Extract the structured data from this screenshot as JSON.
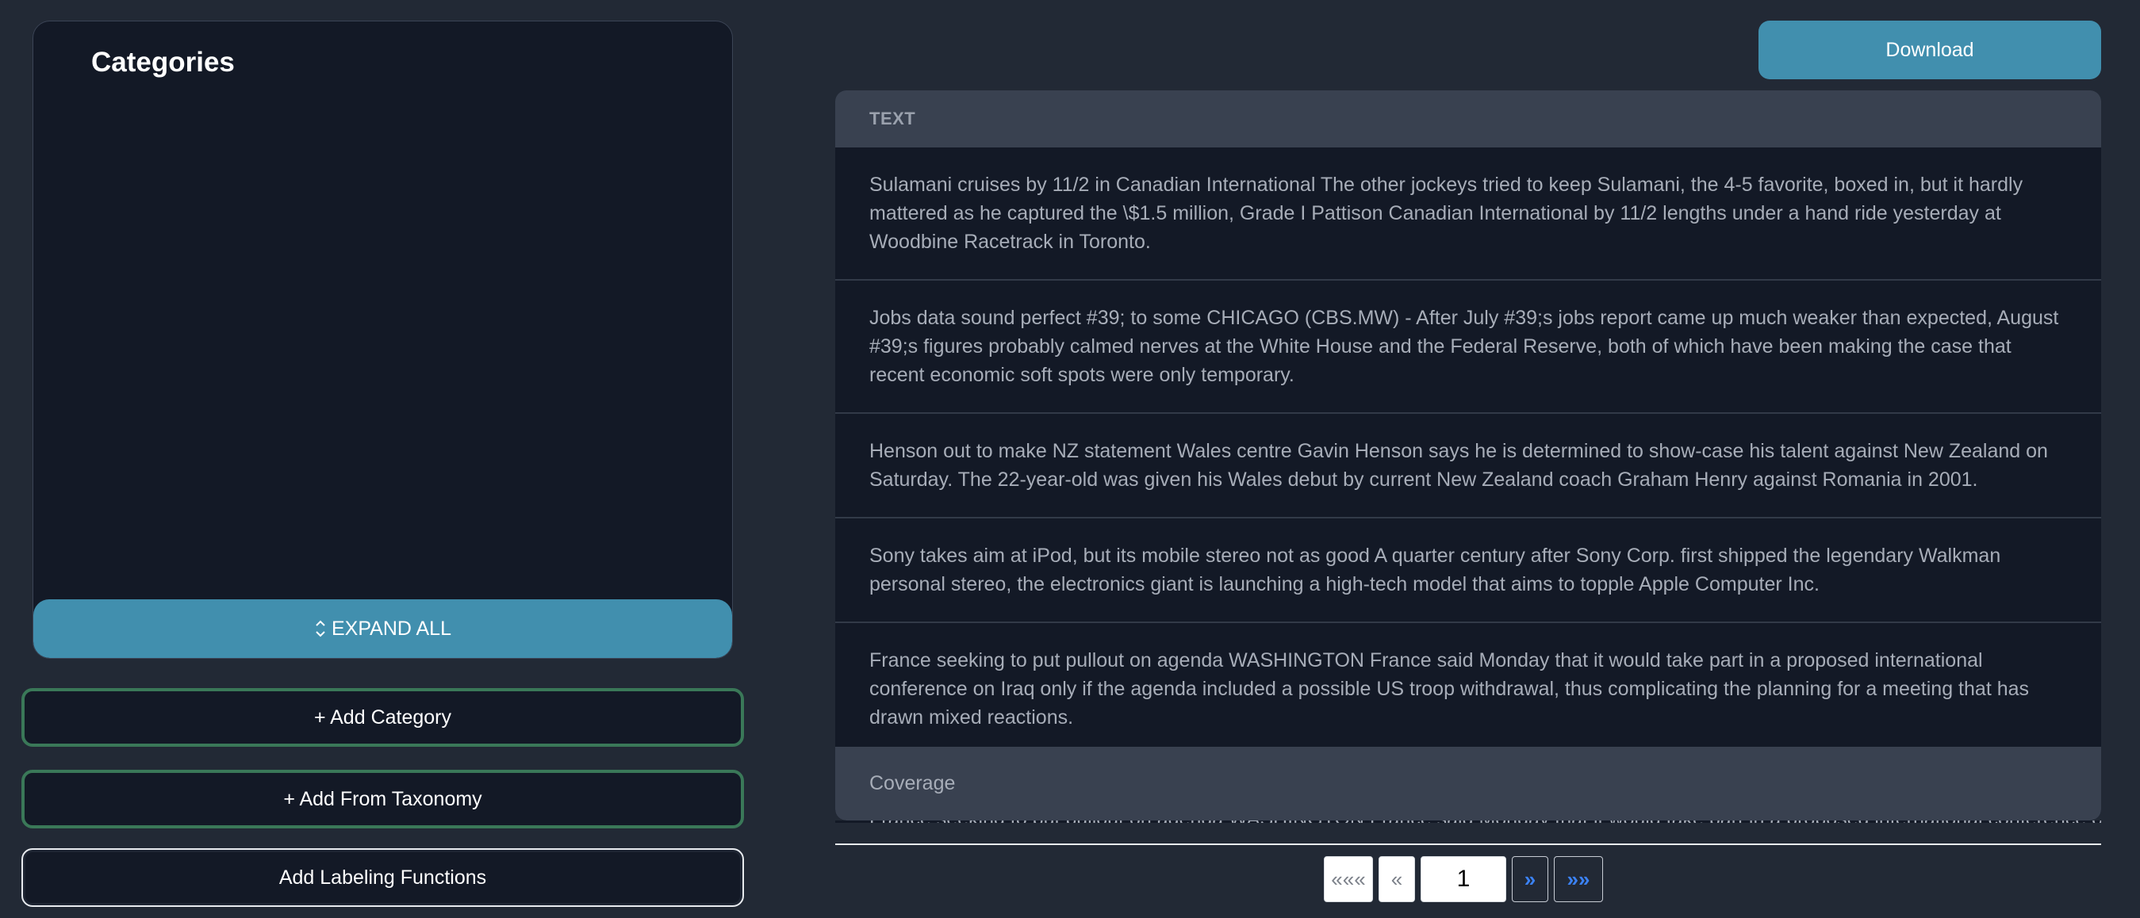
{
  "sidebar": {
    "title": "Categories",
    "expand_all_label": "EXPAND ALL",
    "expand_icon": "chevron-up-down-icon",
    "add_category_label": "+ Add Category",
    "add_from_taxonomy_label": "+ Add From Taxonomy",
    "add_labeling_functions_label": "Add Labeling Functions"
  },
  "toolbar": {
    "download_label": "Download"
  },
  "table": {
    "column_header": "TEXT",
    "rows": [
      {
        "text": "Sulamani cruises by 11/2 in Canadian International The other jockeys tried to keep Sulamani, the 4-5 favorite, boxed in, but it hardly mattered as he captured the \\$1.5 million, Grade I Pattison Canadian International by 11/2 lengths under a hand ride yesterday at Woodbine Racetrack in Toronto."
      },
      {
        "text": "Jobs data sound perfect #39; to some CHICAGO (CBS.MW) - After July #39;s jobs report came up much weaker than expected, August #39;s figures probably calmed nerves at the White House and the Federal Reserve, both of which have been making the case that recent economic soft spots were only temporary."
      },
      {
        "text": "Henson out to make NZ statement Wales centre Gavin Henson says he is determined to show-case his talent against New Zealand on Saturday. The 22-year-old was given his Wales debut by current New Zealand coach Graham Henry against Romania in 2001."
      },
      {
        "text": "Sony takes aim at iPod, but its mobile stereo not as good A quarter century after Sony Corp. first shipped the legendary Walkman personal stereo, the electronics giant is launching a high-tech model that aims to topple Apple Computer Inc."
      },
      {
        "text": "France seeking to put pullout on agenda WASHINGTON France said Monday that it would take part in a proposed international conference on Iraq only if the agenda included a possible US troop withdrawal, thus complicating the planning for a meeting that has drawn mixed reactions."
      }
    ],
    "footer_label": "Coverage"
  },
  "pagination": {
    "first_label": "«««",
    "prev_label": "«",
    "current_page": "1",
    "next_label": "»",
    "last_label": "»»"
  },
  "colors": {
    "accent": "#418fae",
    "add_border": "#3a7858",
    "page_bg": "#222935",
    "panel_bg": "#131926",
    "link_blue": "#3b82f6"
  }
}
